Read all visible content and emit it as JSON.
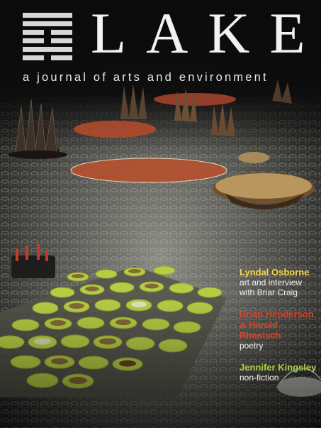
{
  "journal": {
    "title": "LAKE",
    "subtitle": "a journal of arts and environment"
  },
  "contents": [
    {
      "name": "Lyndal Osborne",
      "desc_lines": [
        "art and interview",
        "with Briar Craig"
      ],
      "color": "#f2d94a"
    },
    {
      "name": "Brian Henderson & Harold Rhenisch",
      "name_lines": [
        "Brian Henderson",
        "& Harold Rhenisch"
      ],
      "desc_lines": [
        "poetry"
      ],
      "color": "#d8442b"
    },
    {
      "name": "Jennifer Kingsley",
      "desc_lines": [
        "non-fiction"
      ],
      "color": "#a6d042"
    }
  ],
  "colors": {
    "logo": "#d7d7d7",
    "text": "#f0f0f0"
  }
}
